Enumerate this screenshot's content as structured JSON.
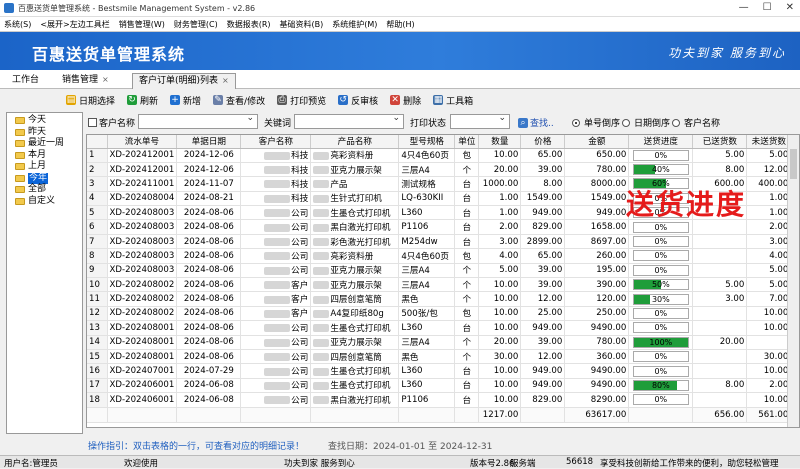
{
  "window": {
    "title": "百惠送货单管理系统 - Bestsmile Management System - v2.86",
    "controls": [
      "—",
      "☐",
      "✕"
    ]
  },
  "menu": [
    "系统(S)",
    "<展开>左边工具栏",
    "销售管理(W)",
    "财务管理(C)",
    "数据报表(R)",
    "基础资料(B)",
    "系统维护(M)",
    "帮助(H)"
  ],
  "banner": {
    "title": "百惠送货单管理系统",
    "slogan": "功夫到家 服务到心"
  },
  "tabs": [
    {
      "label": "工作台"
    },
    {
      "label": "销售管理",
      "close": "×"
    },
    {
      "label": "客户订单(明细)列表",
      "close": "×"
    }
  ],
  "toolbar": [
    {
      "label": "日期选择",
      "icon": "calendar-icon",
      "color": "#e2a400",
      "glyph": "▤"
    },
    {
      "label": "刷新",
      "icon": "refresh-icon",
      "color": "#1f9d3a",
      "glyph": "↻"
    },
    {
      "label": "新增",
      "icon": "add-icon",
      "color": "#1f6fd0",
      "glyph": "+"
    },
    {
      "label": "查看/修改",
      "icon": "edit-icon",
      "color": "#6a7fa8",
      "glyph": "✎"
    },
    {
      "label": "打印预览",
      "icon": "print-preview-icon",
      "color": "#5a5a5a",
      "glyph": "⎙"
    },
    {
      "label": "反审核",
      "icon": "unaudit-icon",
      "color": "#2a6fc8",
      "glyph": "↺"
    },
    {
      "label": "删除",
      "icon": "delete-icon",
      "color": "#d0443a",
      "glyph": "✕"
    },
    {
      "label": "工具箱",
      "icon": "toolbox-icon",
      "color": "#3d6fa8",
      "glyph": "▦"
    }
  ],
  "tree": {
    "items": [
      "今天",
      "昨天",
      "最近一周",
      "本月",
      "上月",
      "今年",
      "全部",
      "自定义"
    ],
    "selected": "今年"
  },
  "filter": {
    "customer_label": "客户名称",
    "keyword_label": "关键词",
    "print_status_label": "打印状态",
    "search_label": "查找..",
    "sort_options": [
      "单号倒序",
      "日期倒序",
      "客户名称"
    ],
    "sort_selected": "单号倒序"
  },
  "grid": {
    "headers": [
      "流水单号",
      "单据日期",
      "客户名称",
      "产品名称",
      "型号规格",
      "单位",
      "数量",
      "价格",
      "金额",
      "送货进度",
      "已送货数",
      "未送货数"
    ],
    "rows": [
      {
        "no": "1",
        "order": "XD-202412001",
        "date": "2024-12-06",
        "customer": "科技",
        "product": "亮彩资料册",
        "model": "4只4色60页",
        "unit": "包",
        "qty": "10.00",
        "price": "65.00",
        "amount": "650.00",
        "progress": "0%",
        "progress_value": 0,
        "delivered": "5.00",
        "pending": "5.00"
      },
      {
        "no": "2",
        "order": "XD-202412001",
        "date": "2024-12-06",
        "customer": "科技",
        "product": "亚克力展示架",
        "model": "三层A4",
        "unit": "个",
        "qty": "20.00",
        "price": "39.00",
        "amount": "780.00",
        "progress": "40%",
        "progress_value": 40,
        "delivered": "8.00",
        "pending": "12.00"
      },
      {
        "no": "3",
        "order": "XD-202411001",
        "date": "2024-11-07",
        "customer": "科技",
        "product": "产品",
        "model": "测试规格",
        "unit": "台",
        "qty": "1000.00",
        "price": "8.00",
        "amount": "8000.00",
        "progress": "60%",
        "progress_value": 60,
        "delivered": "600.00",
        "pending": "400.00"
      },
      {
        "no": "4",
        "order": "XD-202408004",
        "date": "2024-08-21",
        "customer": "科技",
        "product": "生针式打印机",
        "model": "LQ-630KII",
        "unit": "台",
        "qty": "1.00",
        "price": "1549.00",
        "amount": "1549.00",
        "progress": "0%",
        "progress_value": 0,
        "delivered": "",
        "pending": "1.00"
      },
      {
        "no": "5",
        "order": "XD-202408003",
        "date": "2024-08-06",
        "customer": "公司",
        "product": "生墨仓式打印机",
        "model": "L360",
        "unit": "台",
        "qty": "1.00",
        "price": "949.00",
        "amount": "949.00",
        "progress": "0%",
        "progress_value": 0,
        "delivered": "",
        "pending": "1.00"
      },
      {
        "no": "6",
        "order": "XD-202408003",
        "date": "2024-08-06",
        "customer": "公司",
        "product": "黑白激光打印机",
        "model": "P1106",
        "unit": "台",
        "qty": "2.00",
        "price": "829.00",
        "amount": "1658.00",
        "progress": "0%",
        "progress_value": 0,
        "delivered": "",
        "pending": "2.00"
      },
      {
        "no": "7",
        "order": "XD-202408003",
        "date": "2024-08-06",
        "customer": "公司",
        "product": "彩色激光打印机",
        "model": "M254dw",
        "unit": "台",
        "qty": "3.00",
        "price": "2899.00",
        "amount": "8697.00",
        "progress": "0%",
        "progress_value": 0,
        "delivered": "",
        "pending": "3.00"
      },
      {
        "no": "8",
        "order": "XD-202408003",
        "date": "2024-08-06",
        "customer": "公司",
        "product": "亮彩资料册",
        "model": "4只4色60页",
        "unit": "包",
        "qty": "4.00",
        "price": "65.00",
        "amount": "260.00",
        "progress": "0%",
        "progress_value": 0,
        "delivered": "",
        "pending": "4.00"
      },
      {
        "no": "9",
        "order": "XD-202408003",
        "date": "2024-08-06",
        "customer": "公司",
        "product": "亚克力展示架",
        "model": "三层A4",
        "unit": "个",
        "qty": "5.00",
        "price": "39.00",
        "amount": "195.00",
        "progress": "0%",
        "progress_value": 0,
        "delivered": "",
        "pending": "5.00"
      },
      {
        "no": "10",
        "order": "XD-202408002",
        "date": "2024-08-06",
        "customer": "客户",
        "product": "亚克力展示架",
        "model": "三层A4",
        "unit": "个",
        "qty": "10.00",
        "price": "39.00",
        "amount": "390.00",
        "progress": "50%",
        "progress_value": 50,
        "delivered": "5.00",
        "pending": "5.00"
      },
      {
        "no": "11",
        "order": "XD-202408002",
        "date": "2024-08-06",
        "customer": "客户",
        "product": "四层创意笔筒",
        "model": "黑色",
        "unit": "个",
        "qty": "10.00",
        "price": "12.00",
        "amount": "120.00",
        "progress": "30%",
        "progress_value": 30,
        "delivered": "3.00",
        "pending": "7.00"
      },
      {
        "no": "12",
        "order": "XD-202408002",
        "date": "2024-08-06",
        "customer": "客户",
        "product": "A4复印纸80g",
        "model": "500张/包",
        "unit": "包",
        "qty": "10.00",
        "price": "25.00",
        "amount": "250.00",
        "progress": "0%",
        "progress_value": 0,
        "delivered": "",
        "pending": "10.00"
      },
      {
        "no": "13",
        "order": "XD-202408001",
        "date": "2024-08-06",
        "customer": "公司",
        "product": "生墨仓式打印机",
        "model": "L360",
        "unit": "台",
        "qty": "10.00",
        "price": "949.00",
        "amount": "9490.00",
        "progress": "0%",
        "progress_value": 0,
        "delivered": "",
        "pending": "10.00"
      },
      {
        "no": "14",
        "order": "XD-202408001",
        "date": "2024-08-06",
        "customer": "公司",
        "product": "亚克力展示架",
        "model": "三层A4",
        "unit": "个",
        "qty": "20.00",
        "price": "39.00",
        "amount": "780.00",
        "progress": "100%",
        "progress_value": 100,
        "delivered": "20.00",
        "pending": ""
      },
      {
        "no": "15",
        "order": "XD-202408001",
        "date": "2024-08-06",
        "customer": "公司",
        "product": "四层创意笔筒",
        "model": "黑色",
        "unit": "个",
        "qty": "30.00",
        "price": "12.00",
        "amount": "360.00",
        "progress": "0%",
        "progress_value": 0,
        "delivered": "",
        "pending": "30.00"
      },
      {
        "no": "16",
        "order": "XD-202407001",
        "date": "2024-07-29",
        "customer": "公司",
        "product": "生墨仓式打印机",
        "model": "L360",
        "unit": "台",
        "qty": "10.00",
        "price": "949.00",
        "amount": "9490.00",
        "progress": "0%",
        "progress_value": 0,
        "delivered": "",
        "pending": "10.00"
      },
      {
        "no": "17",
        "order": "XD-202406001",
        "date": "2024-06-08",
        "customer": "公司",
        "product": "生墨仓式打印机",
        "model": "L360",
        "unit": "台",
        "qty": "10.00",
        "price": "949.00",
        "amount": "9490.00",
        "progress": "80%",
        "progress_value": 80,
        "delivered": "8.00",
        "pending": "2.00"
      },
      {
        "no": "18",
        "order": "XD-202406001",
        "date": "2024-06-08",
        "customer": "公司",
        "product": "黑白激光打印机",
        "model": "P1106",
        "unit": "台",
        "qty": "10.00",
        "price": "829.00",
        "amount": "8290.00",
        "progress": "0%",
        "progress_value": 0,
        "delivered": "",
        "pending": "10.00"
      }
    ],
    "totals": {
      "qty": "1217.00",
      "amount": "63617.00",
      "delivered": "656.00",
      "pending": "561.00"
    }
  },
  "overlay_text": "送货进度",
  "hint": {
    "text": "操作指引：双击表格的一行，可查看对应的明细记录！",
    "range_label": "查找日期：2024-01-01 至 2024-12-31"
  },
  "status": {
    "user": "用户名:管理员",
    "welcome": "欢迎使用",
    "motto": "功夫到家 服务到心",
    "version": "版本号2.86",
    "service": "服务端",
    "port": "56618",
    "ad": "享受科技创新给工作带来的便利，助您轻松管理"
  },
  "colors": {
    "banner": "#1f6ccf",
    "progress": "#1f9d3a",
    "overlay": "#e51b1b",
    "selection": "#0a64d8"
  }
}
